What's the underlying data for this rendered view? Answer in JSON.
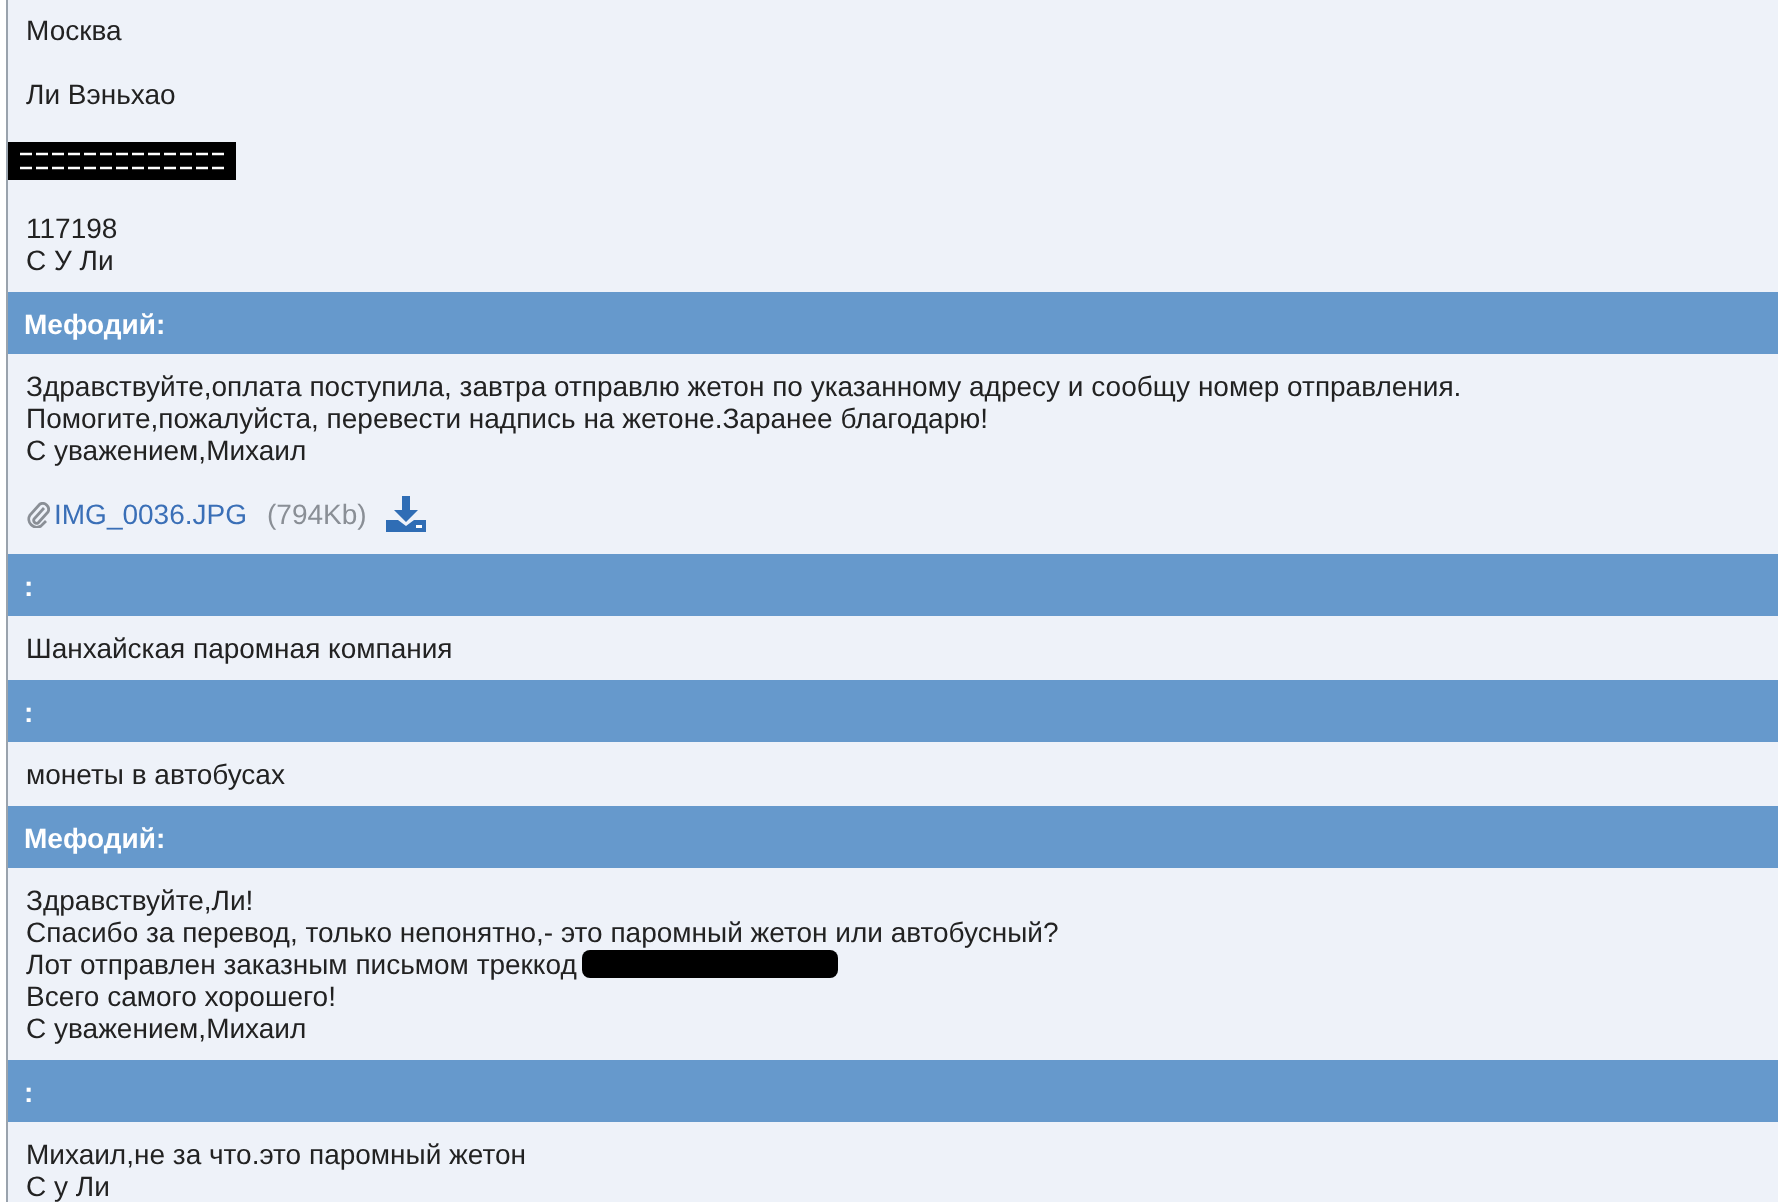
{
  "messages": [
    {
      "paragraphs": [
        {
          "lines": [
            {
              "text": "Москва",
              "redacted": false
            }
          ]
        },
        {
          "lines": [
            {
              "text": "Ли Вэньхао",
              "redacted": false
            }
          ]
        },
        {
          "lines": [
            {
              "kind": "redaction"
            }
          ]
        },
        {
          "lines": [
            {
              "text": "117198",
              "redacted": false
            },
            {
              "text": "С У Ли",
              "redacted": false
            }
          ]
        }
      ]
    },
    {
      "header": "Мефодий:",
      "paragraphs": [
        {
          "lines": [
            {
              "text": "Здравствуйте,оплата поступила, завтра отправлю жетон по указанному адресу и сообщу номер отправления.",
              "redacted": false
            },
            {
              "text": "Помогите,пожалуйста, перевести надпись на жетоне.Заранее благодарю!",
              "redacted": false
            },
            {
              "text": "С уважением,Михаил",
              "redacted": false
            }
          ]
        }
      ],
      "attachment": {
        "file": "IMG_0036.JPG",
        "size": "(794Kb)"
      }
    },
    {
      "header": ":",
      "paragraphs": [
        {
          "lines": [
            {
              "text": "Шанхайская паромная компания",
              "redacted": false
            }
          ]
        }
      ]
    },
    {
      "header": ":",
      "paragraphs": [
        {
          "lines": [
            {
              "text": "монеты в автобусах",
              "redacted": false
            }
          ]
        }
      ]
    },
    {
      "header": "Мефодий:",
      "paragraphs": [
        {
          "lines": [
            {
              "text": "Здравствуйте,Ли!",
              "redacted": false
            },
            {
              "text": "Спасибо за перевод, только непонятно,- это паромный жетон или автобусный?",
              "redacted": false
            },
            {
              "text": "Лот отправлен заказным письмом треккод",
              "redacted": true
            },
            {
              "text": "Всего самого хорошего!",
              "redacted": false
            },
            {
              "text": "С уважением,Михаил",
              "redacted": false
            }
          ]
        }
      ]
    },
    {
      "header": ":",
      "paragraphs": [
        {
          "lines": [
            {
              "text": "Михаил,не за что.это паромный жетон",
              "redacted": false
            },
            {
              "text": "С у Ли",
              "redacted": false
            }
          ]
        }
      ]
    }
  ]
}
